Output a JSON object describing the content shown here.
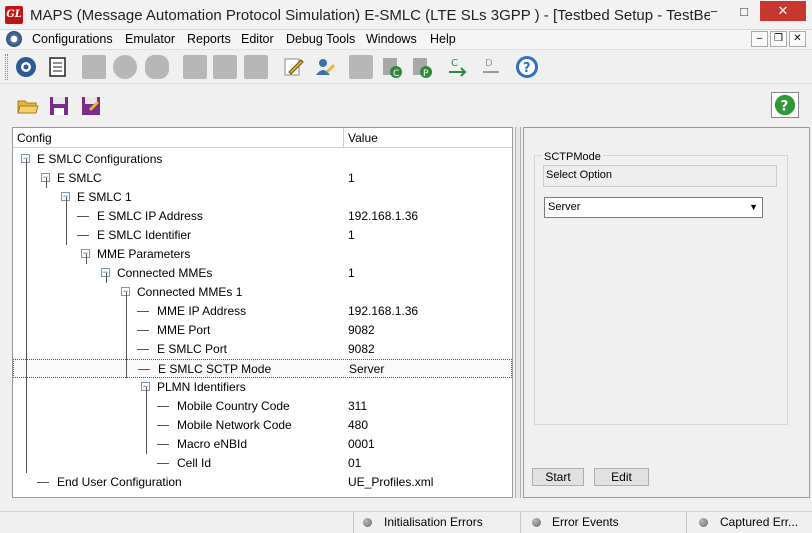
{
  "window": {
    "title": "MAPS (Message Automation Protocol Simulation) E-SMLC (LTE SLs 3GPP ) - [Testbed Setup - TestBe...",
    "logo": "GL",
    "minimize": "−",
    "maximize": "□",
    "close": "✕"
  },
  "menu": {
    "items": [
      "Configurations",
      "Emulator",
      "Reports",
      "Editor",
      "Debug Tools",
      "Windows",
      "Help"
    ],
    "mdi": [
      "–",
      "❐",
      "✕"
    ]
  },
  "tree": {
    "col_config": "Config",
    "col_value": "Value",
    "rows": [
      {
        "label": "E SMLC Configurations",
        "value": ""
      },
      {
        "label": "E SMLC",
        "value": "1"
      },
      {
        "label": "E SMLC 1",
        "value": ""
      },
      {
        "label": "E SMLC IP Address",
        "value": "192.168.1.36"
      },
      {
        "label": "E SMLC Identifier",
        "value": "1"
      },
      {
        "label": "MME Parameters",
        "value": ""
      },
      {
        "label": "Connected MMEs",
        "value": "1"
      },
      {
        "label": "Connected MMEs 1",
        "value": ""
      },
      {
        "label": "MME IP Address",
        "value": "192.168.1.36"
      },
      {
        "label": "MME Port",
        "value": "9082"
      },
      {
        "label": "E SMLC Port",
        "value": "9082"
      },
      {
        "label": "E SMLC SCTP Mode",
        "value": "Server"
      },
      {
        "label": "PLMN Identifiers",
        "value": ""
      },
      {
        "label": "Mobile Country Code",
        "value": "311"
      },
      {
        "label": "Mobile Network Code",
        "value": "480"
      },
      {
        "label": "Macro eNBId",
        "value": "0001"
      },
      {
        "label": "Cell Id",
        "value": "01"
      },
      {
        "label": "End User Configuration",
        "value": "UE_Profiles.xml"
      }
    ]
  },
  "properties": {
    "group_title": "SCTPMode",
    "description": "Select Option",
    "selected_option": "Server",
    "start_label": "Start",
    "edit_label": "Edit"
  },
  "status": {
    "init_errors": "Initialisation Errors",
    "error_events": "Error Events",
    "captured": "Captured Err..."
  },
  "help_label": "?"
}
